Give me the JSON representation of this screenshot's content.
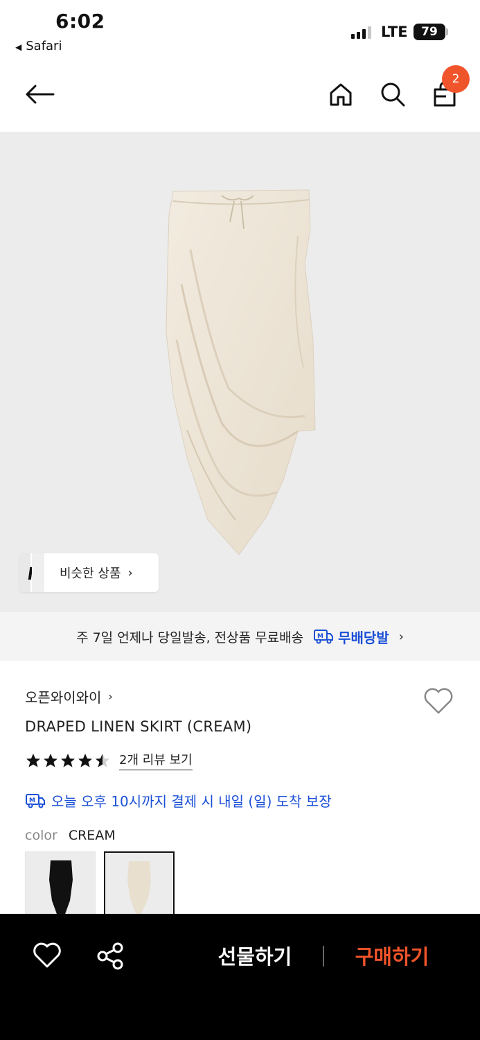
{
  "status_bar": {
    "time": "6:02",
    "back_app": "Safari",
    "network": "LTE",
    "battery": "79"
  },
  "nav": {
    "cart_count": "2",
    "icons": [
      "back-arrow-icon",
      "home-icon",
      "search-icon",
      "shopping-bag-icon"
    ]
  },
  "hero": {
    "similar_label": "비슷한 상품"
  },
  "delivery_banner": {
    "text": "주 7일 언제나 당일발송, 전상품 무료배송",
    "brand": "무배당발"
  },
  "product": {
    "brand": "오픈와이와이",
    "name": "DRAPED LINEN SKIRT (CREAM)",
    "rating": 4.5,
    "review_link": "2개 리뷰 보기",
    "arrival": "오늘 오후 10시까지 결제 시 내일 (일) 도착 보장",
    "color_label": "color",
    "color_value": "CREAM",
    "swatches": [
      "black",
      "cream"
    ]
  },
  "bottom_bar": {
    "gift_label": "선물하기",
    "buy_label": "구매하기"
  },
  "colors": {
    "accent": "#f0542a",
    "link_blue": "#1a4fd6",
    "hero_bg": "#ececec",
    "skirt": "#efe6d8"
  }
}
